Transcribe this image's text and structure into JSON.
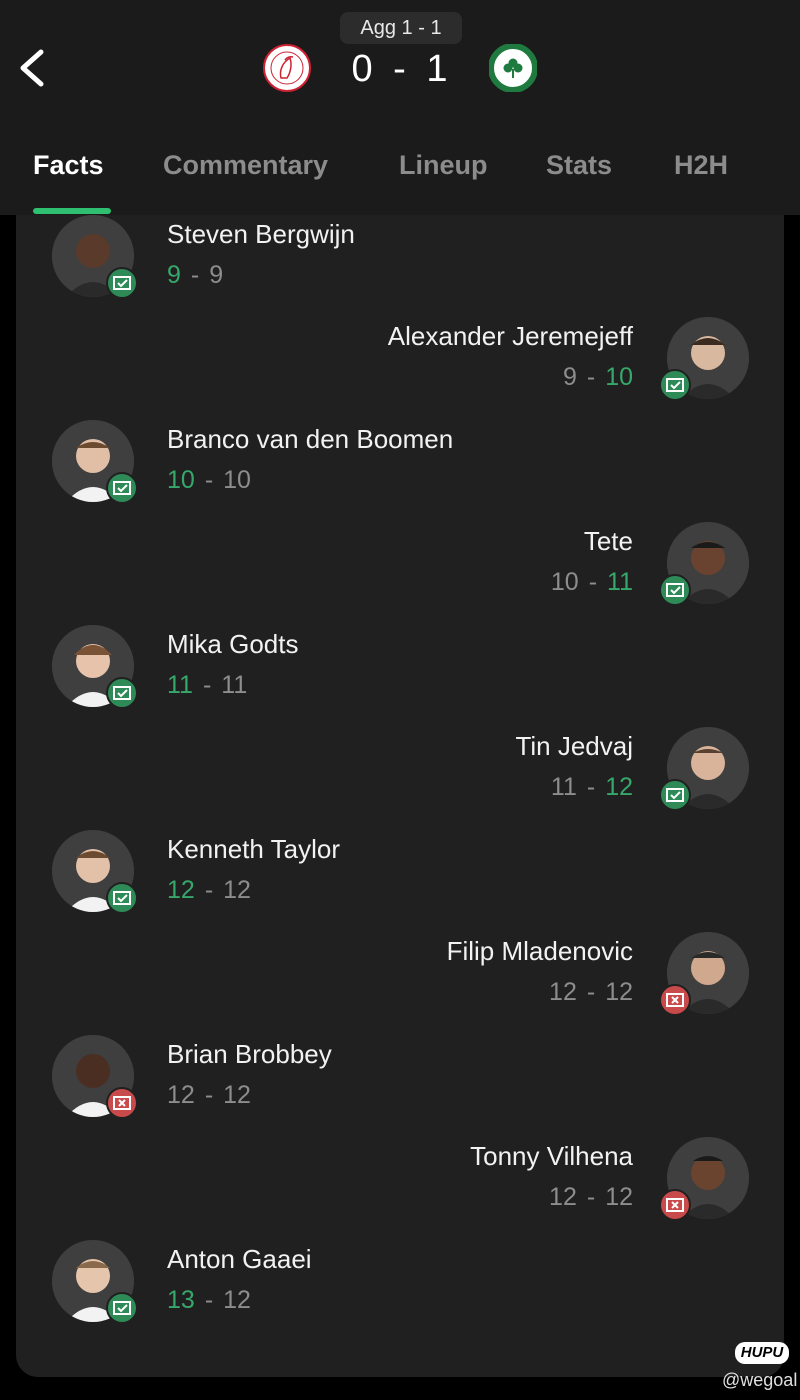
{
  "header": {
    "aggregate": "Agg 1 - 1",
    "home_score": "0",
    "separator": "-",
    "away_score": "1",
    "home_crest_icon": "ajax-crest-icon",
    "away_crest_icon": "panathinaikos-crest-icon"
  },
  "tabs": [
    {
      "label": "Facts",
      "active": true
    },
    {
      "label": "Commentary",
      "active": false
    },
    {
      "label": "Lineup",
      "active": false
    },
    {
      "label": "Stats",
      "active": false
    },
    {
      "label": "H2H",
      "active": false
    }
  ],
  "colors": {
    "accent": "#2fbf71",
    "scored": "#2e8b57",
    "missed": "#c94a4a",
    "highlight_score": "#37a86b"
  },
  "penalties": [
    {
      "name": "Steven Bergwijn",
      "side": "home",
      "result": "scored",
      "home": "9",
      "away": "9"
    },
    {
      "name": "Alexander Jeremejeff",
      "side": "away",
      "result": "scored",
      "home": "9",
      "away": "10"
    },
    {
      "name": "Branco van den Boomen",
      "side": "home",
      "result": "scored",
      "home": "10",
      "away": "10"
    },
    {
      "name": "Tete",
      "side": "away",
      "result": "scored",
      "home": "10",
      "away": "11"
    },
    {
      "name": "Mika Godts",
      "side": "home",
      "result": "scored",
      "home": "11",
      "away": "11"
    },
    {
      "name": "Tin Jedvaj",
      "side": "away",
      "result": "scored",
      "home": "11",
      "away": "12"
    },
    {
      "name": "Kenneth Taylor",
      "side": "home",
      "result": "scored",
      "home": "12",
      "away": "12"
    },
    {
      "name": "Filip Mladenovic",
      "side": "away",
      "result": "missed",
      "home": "12",
      "away": "12"
    },
    {
      "name": "Brian Brobbey",
      "side": "home",
      "result": "missed",
      "home": "12",
      "away": "12"
    },
    {
      "name": "Tonny Vilhena",
      "side": "away",
      "result": "missed",
      "home": "12",
      "away": "12"
    },
    {
      "name": "Anton Gaaei",
      "side": "home",
      "result": "scored",
      "home": "13",
      "away": "12"
    }
  ],
  "watermark": {
    "logo": "HUPU",
    "handle": "@wegoal"
  }
}
